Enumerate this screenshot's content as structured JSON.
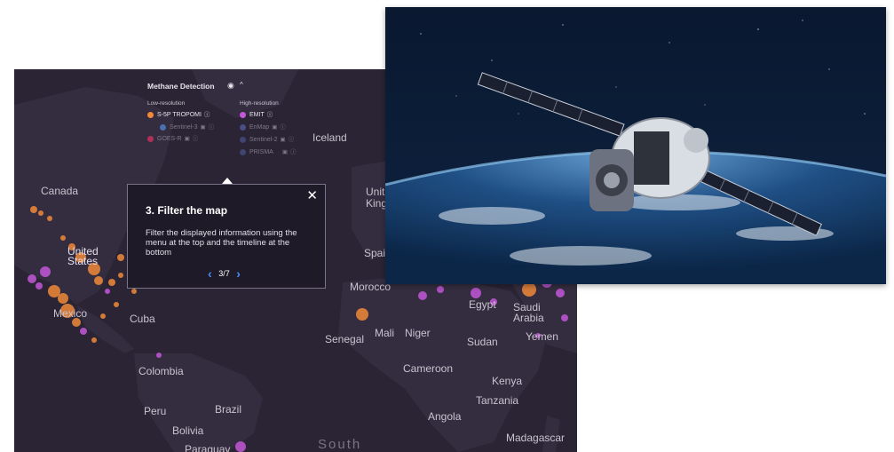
{
  "legend": {
    "title": "Methane Detection",
    "eye_icon": "eye-icon",
    "caret_icon": "chevron-up-icon",
    "low_heading": "Low-resolution",
    "high_heading": "High-resolution",
    "low_items": [
      {
        "label": "S-5P TROPOMI",
        "color": "#f28a3a",
        "active": true
      },
      {
        "label": "Sentinel-3",
        "color": "#4b6fb0",
        "active": false
      },
      {
        "label": "GOES-R",
        "color": "#b0305a",
        "active": false
      }
    ],
    "high_items": [
      {
        "label": "EMIT",
        "color": "#c357d8",
        "active": true
      },
      {
        "label": "EnMap",
        "color": "#4a4e86",
        "active": false
      },
      {
        "label": "Sentinel-2",
        "color": "#3f4570",
        "active": false
      },
      {
        "label": "PRISMA",
        "color": "#3f4570",
        "active": false
      }
    ]
  },
  "tour": {
    "title": "3. Filter the map",
    "body": "Filter the displayed information using the menu at the top and the timeline at the bottom",
    "progress": "3/7",
    "close": "✕",
    "prev": "‹",
    "next": "›"
  },
  "map_labels": {
    "canada": "Canada",
    "iceland": "Iceland",
    "united_kingdom": "Unit\nKingo",
    "united_states": "United\nStates",
    "mexico": "Mexico",
    "cuba": "Cuba",
    "spain": "Spai",
    "morocco": "Morocco",
    "egypt": "Egypt",
    "saudi_arabia": "Saudi\nArabia",
    "yemen": "Yemen",
    "senegal": "Senegal",
    "mali": "Mali",
    "niger": "Niger",
    "sudan": "Sudan",
    "colombia": "Colombia",
    "cameroon": "Cameroon",
    "kenya": "Kenya",
    "tanzania": "Tanzania",
    "peru": "Peru",
    "brazil": "Brazil",
    "angola": "Angola",
    "bolivia": "Bolivia",
    "paraguay": "Paraguay",
    "madagascar": "Madagascar",
    "south": "South"
  },
  "colors": {
    "map_bg": "#2a2434",
    "land": "#342d40",
    "orange": "#f28a3a",
    "purple": "#c357d8",
    "accent_blue": "#4b8df5"
  }
}
